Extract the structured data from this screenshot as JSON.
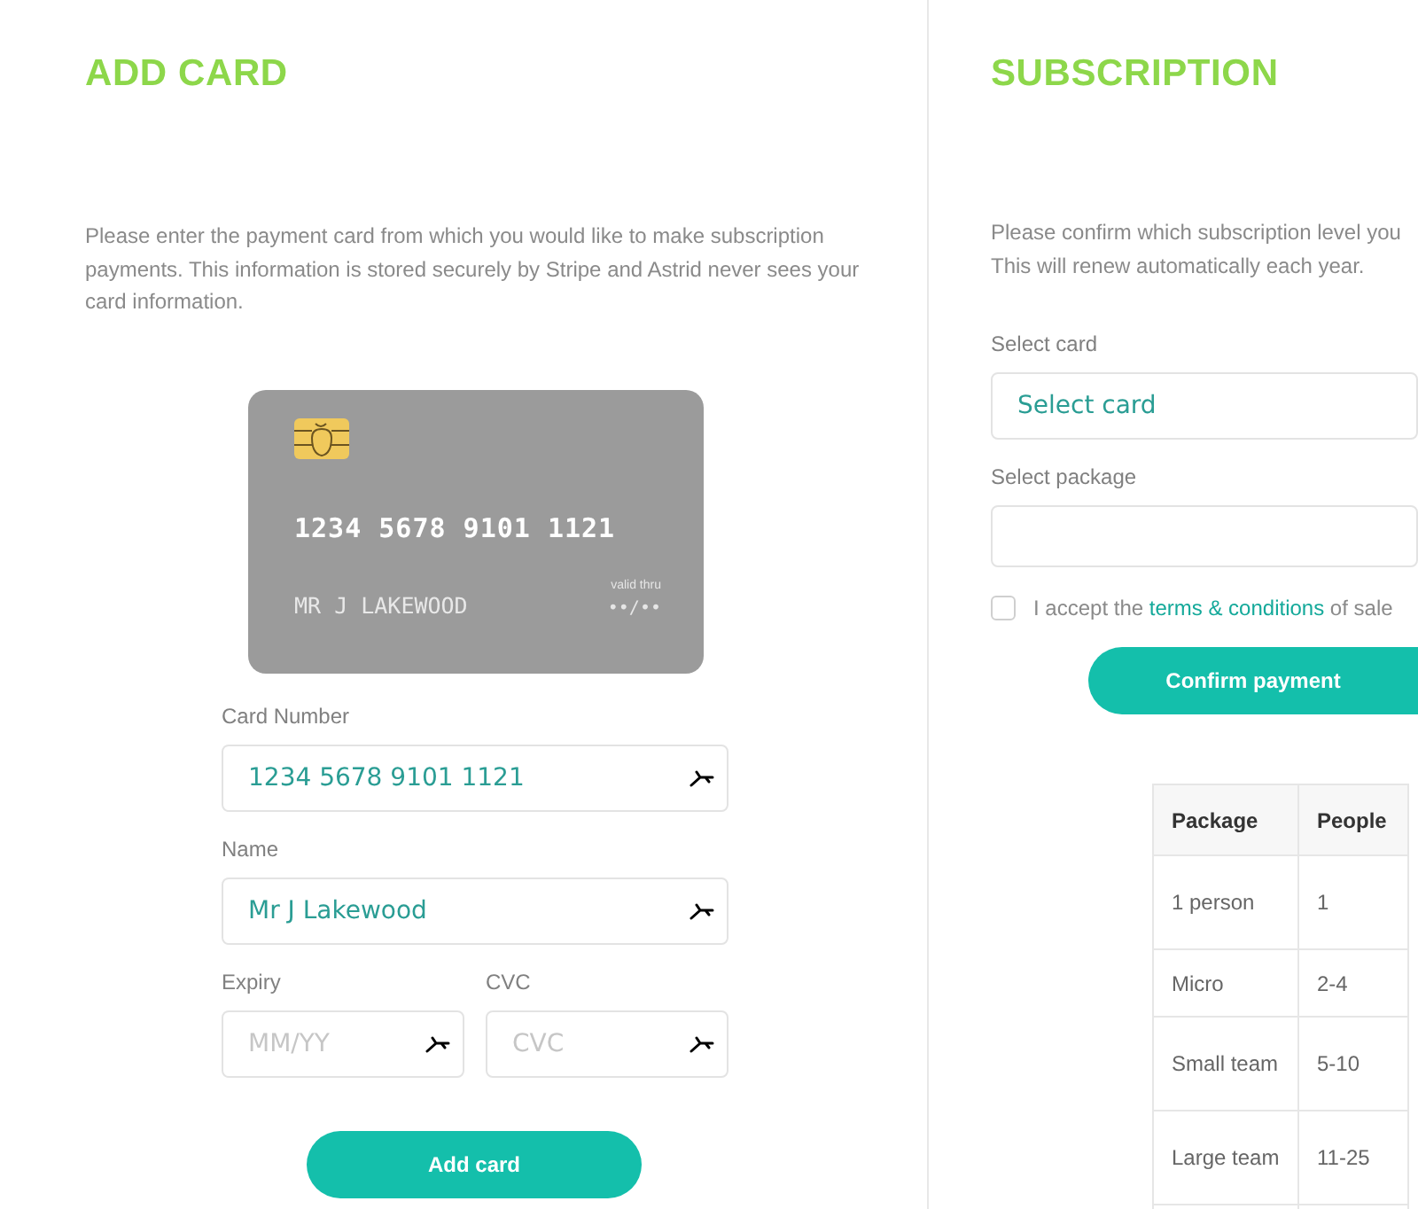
{
  "add_card": {
    "title": "ADD CARD",
    "intro": "Please enter the payment card from which you would like to make subscription payments. This information is stored securely by Stripe and Astrid never sees your card information.",
    "card_preview": {
      "number": "1234 5678 9101 1121",
      "holder": "MR J LAKEWOOD",
      "valid_label": "valid thru",
      "expiry": "••/••"
    },
    "fields": [
      {
        "label": "Card Number",
        "value": "1234 5678 9101 1121"
      },
      {
        "label": "Name",
        "value": "Mr J Lakewood"
      },
      {
        "label": "Expiry",
        "placeholder": "MM/YY"
      },
      {
        "label": "CVC",
        "placeholder": "CVC"
      }
    ],
    "button": "Add card"
  },
  "subscription": {
    "title": "SUBSCRIPTION",
    "intro_lines": [
      "Please confirm which subscription level you",
      "This will renew automatically each year."
    ],
    "select_card": {
      "label": "Select card",
      "value": "Select card"
    },
    "select_package": {
      "label": "Select package"
    },
    "terms": {
      "checked": false,
      "before": "I accept the",
      "link": "terms & conditions",
      "after": "of sale"
    },
    "button": "Confirm payment",
    "table": {
      "columns": [
        "Package",
        "People"
      ],
      "rows": [
        [
          "1 person",
          "1"
        ],
        [
          "Micro",
          "2-4"
        ],
        [
          "Small team",
          "5-10"
        ],
        [
          "Large team",
          "11-25"
        ]
      ]
    }
  }
}
